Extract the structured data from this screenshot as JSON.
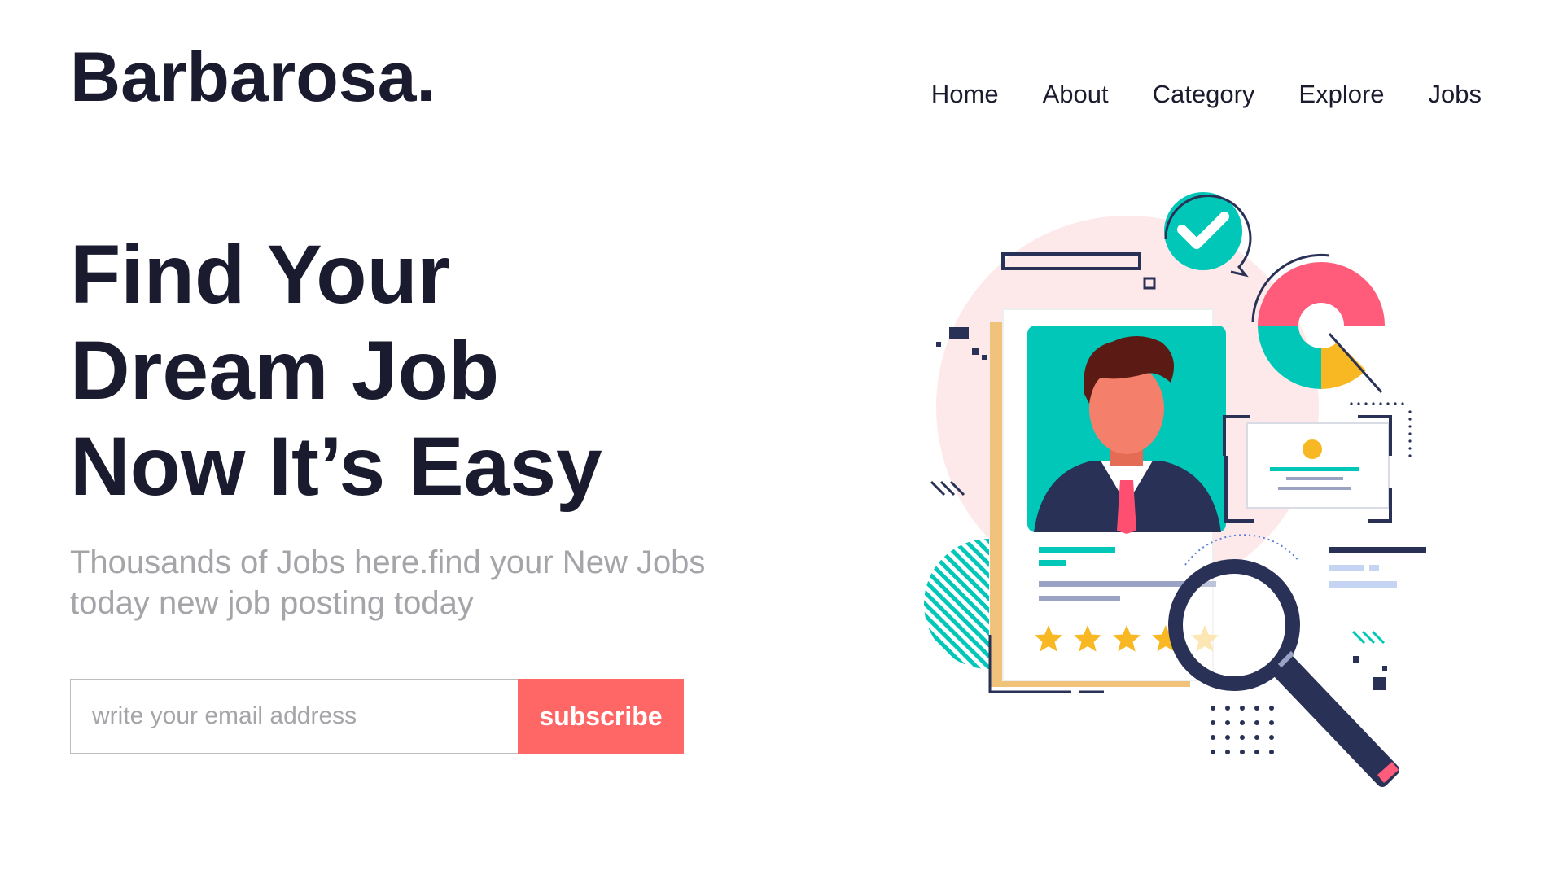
{
  "brand": {
    "logo": "Barbarosa."
  },
  "nav": {
    "items": [
      {
        "label": "Home"
      },
      {
        "label": "About"
      },
      {
        "label": "Category"
      },
      {
        "label": "Explore"
      },
      {
        "label": "Jobs"
      }
    ]
  },
  "hero": {
    "headline_lines": [
      "Find Your",
      "Dream Job",
      "Now It’s Easy"
    ],
    "subtext": "Thousands of Jobs here.find your New Jobs today new job posting today"
  },
  "subscribe": {
    "placeholder": "write your email address",
    "value": "",
    "button_label": "subscribe"
  },
  "illustration": {
    "rating": 4.5,
    "rating_max": 5,
    "icons": [
      "checkmark-icon",
      "magnifier-icon",
      "star-icon",
      "pie-chart-icon",
      "profile-card-icon"
    ]
  },
  "colors": {
    "accent": "#ff6666",
    "teal": "#00c7b7",
    "navy": "#2a3157",
    "gold": "#f8b824",
    "text": "#1b1b2f",
    "muted": "#a5a5a9"
  }
}
